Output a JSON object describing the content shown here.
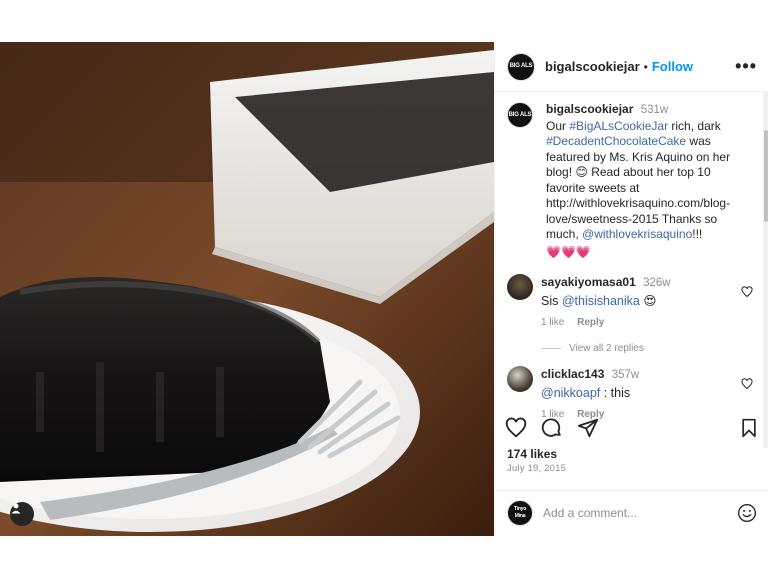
{
  "header": {
    "username": "bigalscookiejar",
    "separator": "•",
    "follow_label": "Follow",
    "more_label": "•••",
    "avatar_text": "BIG ALS"
  },
  "caption": {
    "username": "bigalscookiejar",
    "time": "531w",
    "text_1": "Our ",
    "tag_1": "#BigALsCookieJar",
    "text_2": " rich, dark ",
    "tag_2": "#DecadentChocolateCake",
    "text_3": " was featured by Ms. Kris Aquino on her blog! 😊 Read about her top 10 favorite sweets at http://withlovekrisaquino.com/blog-love/sweetness-2015 Thanks so much, ",
    "tag_3": "@withlovekrisaquino",
    "text_4": "!!!",
    "hearts": "💗💗💗"
  },
  "comments": [
    {
      "username": "sayakiyomasa01",
      "time": "326w",
      "prefix": "Sis ",
      "mention": "@thisishanika",
      "suffix": " 😍",
      "likes": "1 like",
      "reply_label": "Reply",
      "view_replies": "View all 2 replies"
    },
    {
      "username": "clicklac143",
      "time": "357w",
      "prefix": "",
      "mention": "@nikkoapf",
      "suffix": " : this",
      "likes": "1 like",
      "reply_label": "Reply"
    }
  ],
  "likes": "174 likes",
  "date": "July 19, 2015",
  "add_comment": {
    "placeholder": "Add a comment...",
    "avatar_text": "Tinyo Mina"
  },
  "icons": {
    "heart": "heart-icon",
    "comment": "comment-icon",
    "share": "share-icon",
    "bookmark": "bookmark-icon",
    "emoji": "emoji-icon",
    "user_tag": "user-tag-icon"
  },
  "colors": {
    "accent": "#0095f6",
    "tag": "#3d68a3",
    "muted": "#8e8e8e"
  }
}
